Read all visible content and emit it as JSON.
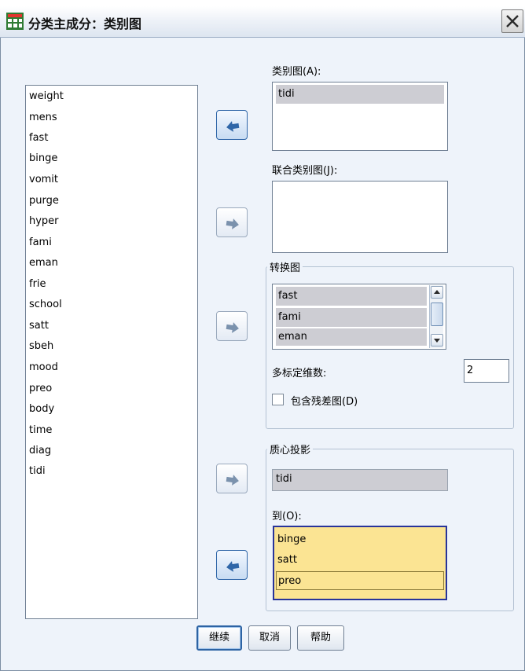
{
  "window": {
    "title": "分类主成分：类别图",
    "close_label": "X"
  },
  "source_list": {
    "items": [
      "weight",
      "mens",
      "fast",
      "binge",
      "vomit",
      "purge",
      "hyper",
      "fami",
      "eman",
      "frie",
      "school",
      "satt",
      "sbeh",
      "mood",
      "preo",
      "body",
      "time",
      "diag",
      "tidi"
    ]
  },
  "category_plots": {
    "label": "类别图(A):",
    "items": [
      "tidi"
    ]
  },
  "joint_category_plots": {
    "label": "联合类别图(J):",
    "items": []
  },
  "transformation_plots": {
    "title": "转换图",
    "items": [
      "fast",
      "fami",
      "eman"
    ],
    "dimensions_label": "多标定维数:",
    "dimensions_value": "2",
    "residuals_label": "包含残差图(D)",
    "residuals_checked": false
  },
  "centroid_projection": {
    "title": "质心投影",
    "variable": "tidi",
    "to_label": "到(O):",
    "to_items": [
      "binge",
      "satt",
      "preo"
    ]
  },
  "buttons": {
    "continue": "继续",
    "cancel": "取消",
    "help": "帮助"
  },
  "colors": {
    "dialog_bg": "#eef3fa",
    "selected_item": "#cdcdd3",
    "target_list_bg": "#fbe493",
    "arrow_active": "#2f66a8"
  }
}
